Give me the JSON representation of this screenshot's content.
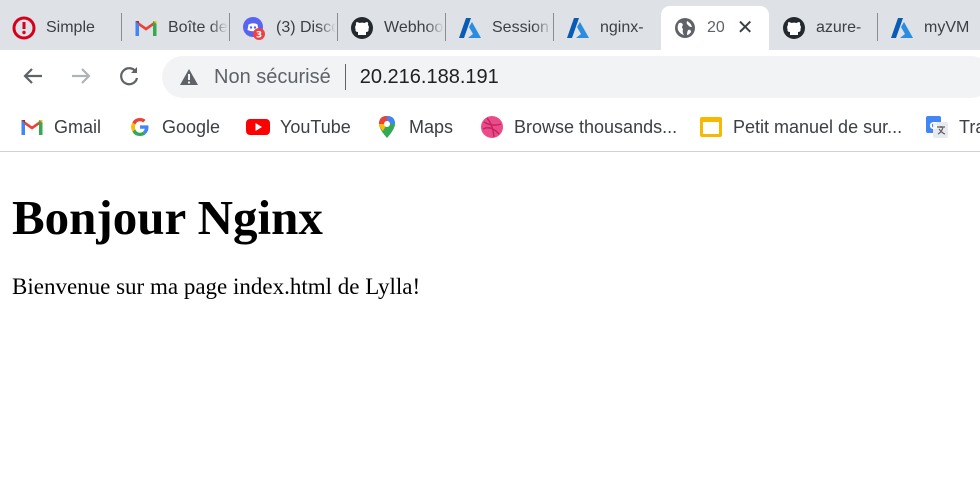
{
  "browser": {
    "tabs": [
      {
        "label": "Simple",
        "icon": "simplon-icon"
      },
      {
        "label": "Boîte de",
        "icon": "gmail-icon"
      },
      {
        "label": "(3) Discord",
        "icon": "discord-icon",
        "badge": "3"
      },
      {
        "label": "Webhook",
        "icon": "github-icon"
      },
      {
        "label": "Session",
        "icon": "azure-icon"
      },
      {
        "label": "nginx-",
        "icon": "azure-icon"
      },
      {
        "label": "20",
        "icon": "globe-icon",
        "active": true,
        "close": "✕"
      },
      {
        "label": "azure-",
        "icon": "github-icon"
      },
      {
        "label": "myVM",
        "icon": "azure-icon"
      }
    ],
    "address_bar": {
      "security_label": "Non sécurisé",
      "url": "20.216.188.191"
    },
    "bookmarks": [
      {
        "label": "Gmail",
        "icon": "gmail-icon"
      },
      {
        "label": "Google",
        "icon": "google-icon"
      },
      {
        "label": "YouTube",
        "icon": "youtube-icon"
      },
      {
        "label": "Maps",
        "icon": "maps-pin-icon"
      },
      {
        "label": "Browse thousands...",
        "icon": "dribbble-icon"
      },
      {
        "label": "Petit manuel de sur...",
        "icon": "yellow-doc-icon"
      },
      {
        "label": "Tra",
        "icon": "google-translate-icon"
      }
    ]
  },
  "page": {
    "heading": "Bonjour Nginx",
    "paragraph": "Bienvenue sur ma page index.html de Lylla!"
  },
  "colors": {
    "tabstrip_bg": "#dee1e6",
    "omnibox_bg": "#f1f3f4",
    "text_dark": "#202124",
    "text_muted": "#5f6368"
  }
}
